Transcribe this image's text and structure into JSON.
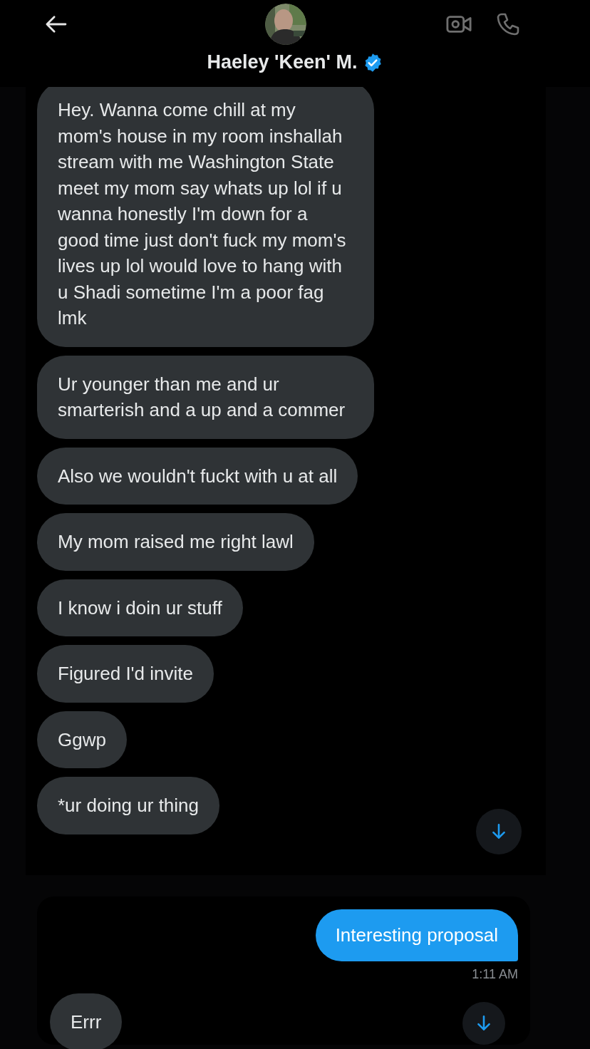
{
  "header": {
    "name": "Haeley 'Keen' M.",
    "verified": true
  },
  "thread": [
    {
      "kind": "received",
      "text": "Hey. Wanna come chill at my mom's house in my room inshallah stream with me Washington State meet my mom say whats up lol if u wanna honestly I'm down for a good time just don't fuck my mom's lives up lol would love to hang with u Shadi sometime I'm a poor fag lmk"
    },
    {
      "kind": "received",
      "text": "Ur younger than me and ur smarterish and a up and a commer"
    },
    {
      "kind": "received",
      "text": "Also we wouldn't fuckt with u at all"
    },
    {
      "kind": "received",
      "text": "My mom raised me right lawl"
    },
    {
      "kind": "received",
      "text": "I know i doin ur stuff"
    },
    {
      "kind": "received",
      "text": "Figured I'd invite"
    },
    {
      "kind": "received",
      "text": "Ggwp"
    },
    {
      "kind": "received",
      "text": "*ur doing ur thing"
    }
  ],
  "reply_thread": [
    {
      "kind": "sent",
      "text": "Interesting proposal",
      "time": "1:11 AM"
    },
    {
      "kind": "received",
      "text": "Errr"
    }
  ]
}
